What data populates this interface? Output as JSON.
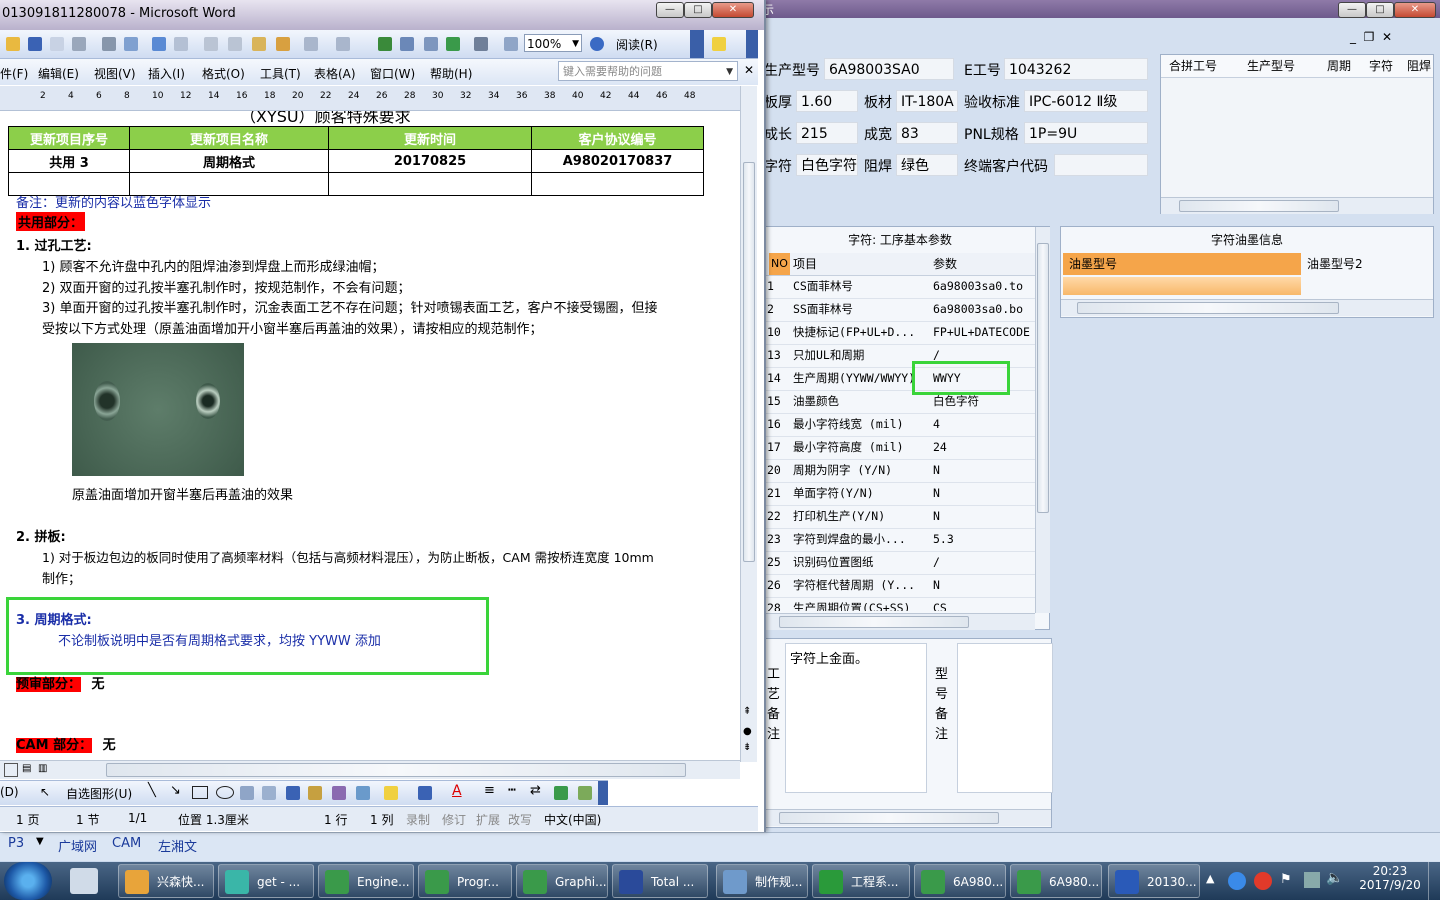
{
  "bg_app": {
    "fields": [
      {
        "label": "生产型号",
        "value": "6A98003SA0"
      },
      {
        "label": "E工号",
        "value": "1043262"
      },
      {
        "label": "板厚",
        "value": "1.60"
      },
      {
        "label": "板材",
        "value": "IT-180A"
      },
      {
        "label": "验收标准",
        "value": "IPC-6012 Ⅱ级"
      },
      {
        "label": "成长",
        "value": "215"
      },
      {
        "label": "成宽",
        "value": "83"
      },
      {
        "label": "PNL规格",
        "value": "1P=9U"
      },
      {
        "label": "字符",
        "value": "白色字符"
      },
      {
        "label": "阻焊",
        "value": "绿色"
      },
      {
        "label": "终端客户代码",
        "value": ""
      }
    ],
    "merge_headers": [
      "合拼工号",
      "生产型号",
      "周期",
      "字符",
      "阻焊"
    ],
    "param_panel": {
      "title": "字符: 工序基本参数",
      "col_no": "NO",
      "col_item": "项目",
      "col_param": "参数",
      "rows": [
        {
          "no": "1",
          "item": "CS面菲林号",
          "param": "6a98003sa0.to"
        },
        {
          "no": "2",
          "item": "SS面菲林号",
          "param": "6a98003sa0.bo"
        },
        {
          "no": "10",
          "item": "快捷标记(FP+UL+D...",
          "param": "FP+UL+DATECODE"
        },
        {
          "no": "13",
          "item": "只加UL和周期",
          "param": "/"
        },
        {
          "no": "14",
          "item": "生产周期(YYWW/WWYY)",
          "param": "WWYY"
        },
        {
          "no": "15",
          "item": "油墨颜色",
          "param": "白色字符"
        },
        {
          "no": "16",
          "item": "最小字符线宽 (mil)",
          "param": "4"
        },
        {
          "no": "17",
          "item": "最小字符高度 (mil)",
          "param": "24"
        },
        {
          "no": "20",
          "item": "周期为阴字 (Y/N)",
          "param": "N"
        },
        {
          "no": "21",
          "item": "单面字符(Y/N)",
          "param": "N"
        },
        {
          "no": "22",
          "item": "打印机生产(Y/N)",
          "param": "N"
        },
        {
          "no": "23",
          "item": "字符到焊盘的最小...",
          "param": "5.3"
        },
        {
          "no": "25",
          "item": "识别码位置图纸",
          "param": "/"
        },
        {
          "no": "26",
          "item": "字符框代替周期 (Y...",
          "param": "N"
        },
        {
          "no": "28",
          "item": "生产周期位置(CS+SS)",
          "param": "CS"
        }
      ]
    },
    "ink_panel": {
      "title": "字符油墨信息",
      "col1": "油墨型号",
      "col2": "油墨型号2"
    },
    "notes": {
      "craft_label": "工艺备注",
      "craft_text": "字符上金面。",
      "model_label": "型号备注"
    },
    "bottom_bar": {
      "tabs": [
        "P3",
        "广域网",
        "CAM",
        "左湘文"
      ]
    }
  },
  "word": {
    "title": "013091811280078 - Microsoft Word",
    "zoom": "100%",
    "read_btn": "阅读(R)",
    "menu": [
      "件(F)",
      "编辑(E)",
      "视图(V)",
      "插入(I)",
      "格式(O)",
      "工具(T)",
      "表格(A)",
      "窗口(W)",
      "帮助(H)"
    ],
    "help_placeholder": "键入需要帮助的问题",
    "ruler": [
      "2",
      "4",
      "6",
      "8",
      "10",
      "12",
      "14",
      "16",
      "18",
      "20",
      "22",
      "24",
      "26",
      "28",
      "30",
      "32",
      "34",
      "36",
      "38",
      "40",
      "42",
      "44",
      "46",
      "48"
    ],
    "heading_partial": "（XYSU）顾客特殊要求",
    "table": {
      "headers": [
        "更新项目序号",
        "更新项目名称",
        "更新时间",
        "客户协议编号"
      ],
      "row": [
        "共用 3",
        "周期格式",
        "20170825",
        "A98020170837"
      ]
    },
    "note": "备注：更新的内容以蓝色字体显示",
    "common_label": "共用部分：",
    "s1_title": "1.   过孔工艺:",
    "s1_items": [
      "1)   顾客不允许盘中孔内的阻焊油渗到焊盘上而形成绿油帽；",
      "2)   双面开窗的过孔按半塞孔制作时，按规范制作，不会有问题；",
      "3)   单面开窗的过孔按半塞孔制作时，沉金表面工艺不存在问题；针对喷锡表面工艺，客户不接受锡圈，但接",
      "       受按以下方式处理（原盖油面增加开小窗半塞后再盖油的效果），请按相应的规范制作；"
    ],
    "image_caption": "原盖油面增加开窗半塞后再盖油的效果",
    "s2_title": "2.   拼板:",
    "s2_items": [
      "1)   对于板边包边的板同时使用了高频率材料（包括与高频材料混压），为防止断板，CAM 需按桥连宽度 10mm",
      "       制作；"
    ],
    "s3_title": "3.  周期格式:",
    "s3_text": "不论制板说明中是否有周期格式要求，均按 YYWW 添加",
    "prepare_label": "预审部分：",
    "prepare_value": "无",
    "cam_label": "CAM 部分：",
    "cam_value": "无",
    "drawing_toolbar": {
      "draw": "(D)",
      "autoshape": "自选图形(U)"
    },
    "status": {
      "page": "1 页",
      "section": "1 节",
      "pages": "1/1",
      "position": "位置 1.3厘米",
      "line": "1 行",
      "col": "1 列",
      "rec": "录制",
      "rev": "修订",
      "ext": "扩展",
      "ovr": "改写",
      "lang": "中文(中国)"
    }
  },
  "taskbar": {
    "items": [
      "兴森快...",
      "get - ...",
      "Engine...",
      "Progr...",
      "Graphi...",
      "Total ...",
      "制作规...",
      "工程系...",
      "6A980...",
      "6A980...",
      "20130..."
    ],
    "time": "20:23",
    "date": "2017/9/20"
  },
  "colors": {
    "highlight_green": "#3ad43a",
    "section_red": "#ff0000",
    "header_green": "#8ccf4a",
    "orange_header": "#f5a54a"
  }
}
